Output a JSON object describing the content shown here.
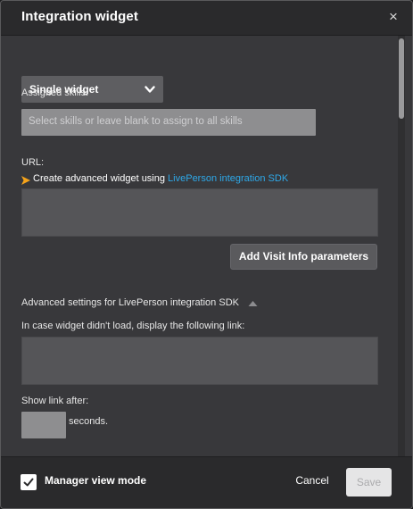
{
  "dialog": {
    "title": "Integration widget",
    "close_glyph": "×"
  },
  "widget_type": {
    "selected": "Single widget"
  },
  "assigned_skills": {
    "label": "Assigned skills:",
    "placeholder": "Select skills or leave blank to assign to all skills"
  },
  "url": {
    "label": "URL:",
    "sdk_prefix": "Create advanced widget using ",
    "sdk_link": "LivePerson integration SDK",
    "value": ""
  },
  "add_visit_button": "Add Visit Info parameters",
  "advanced": {
    "label": "Advanced settings for LivePerson integration SDK",
    "fallback_label": "In case widget didn't load, display the following link:",
    "fallback_value": "",
    "show_link_after_label": "Show link after:",
    "seconds_value": "",
    "seconds_suffix": "seconds."
  },
  "footer": {
    "manager_view_label": "Manager view mode",
    "manager_view_checked": true,
    "cancel_label": "Cancel",
    "save_label": "Save"
  },
  "colors": {
    "link": "#2ea8e8",
    "marker": "#f5a31a",
    "dialog_bg": "#38383b",
    "header_bg": "#2a2a2c"
  },
  "icons": {
    "close": "close-icon",
    "dropdown": "chevron-down-icon",
    "marker": "arrow-right-icon",
    "collapse": "caret-up-icon",
    "check": "checkmark-icon"
  }
}
